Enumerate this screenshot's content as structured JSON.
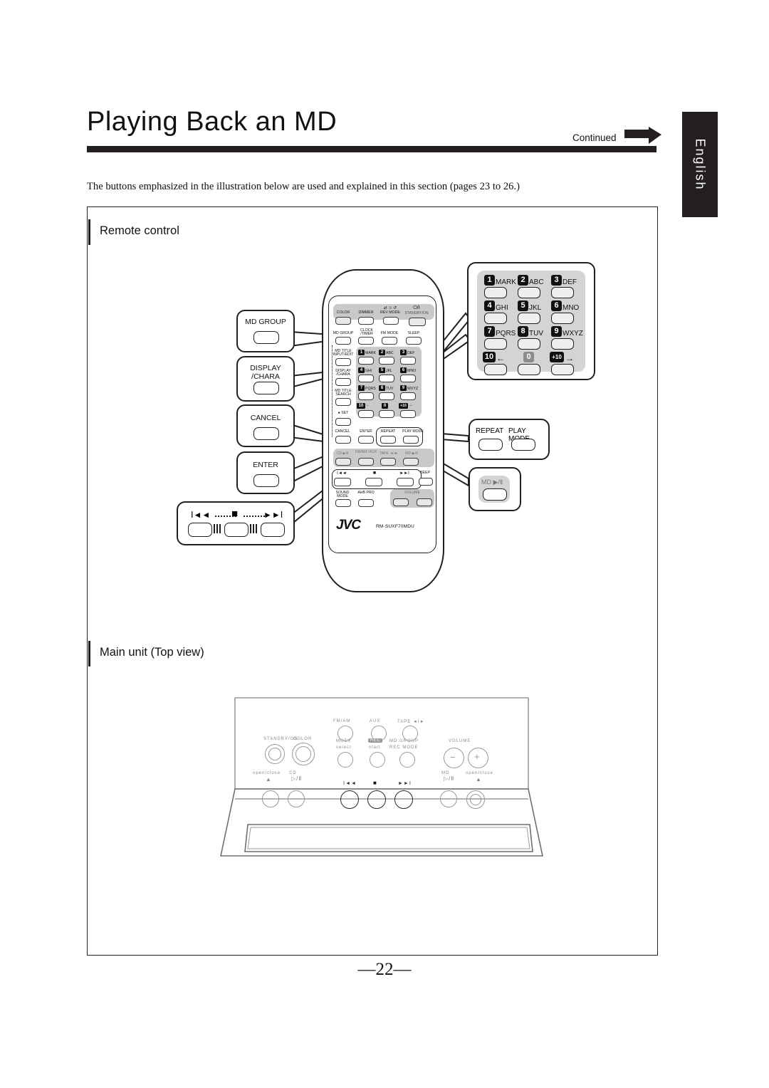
{
  "page": {
    "title": "Playing Back an MD",
    "continued": "Continued",
    "intro": "The buttons emphasized in the illustration below are used and explained in this section (pages 23 to 26.)",
    "language_tab": "English",
    "page_number": "—22—"
  },
  "sections": {
    "remote": "Remote control",
    "main_unit": "Main unit (Top view)"
  },
  "remote": {
    "brand": "JVC",
    "model": "RM-SUXF70MDU",
    "row_top": [
      {
        "label": "COLOR"
      },
      {
        "label": "DIMMER"
      },
      {
        "label": "REV MODE"
      },
      {
        "label": "STANDBY/ON"
      }
    ],
    "row_two": [
      {
        "label": "MD GROUP"
      },
      {
        "label": "CLOCK /TIMER"
      },
      {
        "label": "FM MODE"
      },
      {
        "label": "SLEEP"
      }
    ],
    "left_column": [
      {
        "label": "MD TITLE INPUT/EDIT"
      },
      {
        "label": "DISPLAY /CHARA"
      },
      {
        "label": "MD TITLE SEARCH"
      },
      {
        "label": "● SET"
      }
    ],
    "keypad": [
      {
        "num": "1",
        "letters": "MARK"
      },
      {
        "num": "2",
        "letters": "ABC"
      },
      {
        "num": "3",
        "letters": "DEF"
      },
      {
        "num": "4",
        "letters": "GHI"
      },
      {
        "num": "5",
        "letters": "JKL"
      },
      {
        "num": "6",
        "letters": "MNO"
      },
      {
        "num": "7",
        "letters": "PQRS"
      },
      {
        "num": "8",
        "letters": "TUV"
      },
      {
        "num": "9",
        "letters": "WXYZ"
      },
      {
        "num": "10",
        "letters": "←"
      },
      {
        "num": "0",
        "letters": ""
      },
      {
        "num": "+10",
        "letters": "→"
      }
    ],
    "row_cancel": [
      {
        "label": "CANCEL"
      },
      {
        "label": "ENTER"
      },
      {
        "label": "REPEAT"
      },
      {
        "label": "PLAY MODE"
      }
    ],
    "row_source": [
      {
        "label": "CD ▶/Ⅱ"
      },
      {
        "label": "FM/AM /AUX"
      },
      {
        "label": "TAPE ◄Ⅰ►"
      },
      {
        "label": "MD ▶/Ⅱ"
      }
    ],
    "row_transport": {
      "rew": "Ⅰ◄◄",
      "stop": "■",
      "ff": "►►Ⅰ",
      "beep": "BEEP"
    },
    "row_sound": [
      {
        "label": "SOUND MODE"
      },
      {
        "label": "AHB PRO"
      },
      {
        "label": "VOLUME"
      }
    ]
  },
  "callouts": {
    "left": [
      {
        "label": "MD GROUP"
      },
      {
        "label": "DISPLAY /CHARA"
      },
      {
        "label": "CANCEL"
      },
      {
        "label": "ENTER"
      }
    ],
    "transport": {
      "rew": "Ⅰ◄◄",
      "stop": "■",
      "ff": "►►Ⅰ"
    },
    "keypad_title": "",
    "repeat_playmode": [
      {
        "label": "REPEAT"
      },
      {
        "label": "PLAY MODE"
      }
    ],
    "md_play": {
      "label": "MD ▶/Ⅱ"
    }
  },
  "main_unit": {
    "left_controls": [
      {
        "label": "STANDBY/ON"
      },
      {
        "label": "COLOR"
      }
    ],
    "source_row": [
      {
        "label": "FM/AM"
      },
      {
        "label": "AUX"
      },
      {
        "label": "TAPE ◄Ⅰ►"
      }
    ],
    "mode_row": [
      {
        "label": "MODE",
        "sub": "select"
      },
      {
        "label": "REC",
        "sub": "start"
      },
      {
        "label": "MD GROUP",
        "sub": "REC MODE"
      }
    ],
    "volume": {
      "label": "VOLUME",
      "minus": "−",
      "plus": "+"
    },
    "front_left": {
      "open_close": "open/close",
      "cd": "CD",
      "eject": "▲",
      "play": "▷/Ⅱ"
    },
    "front_center": [
      {
        "label": "Ⅰ◄◄"
      },
      {
        "label": "■"
      },
      {
        "label": "►►Ⅰ"
      }
    ],
    "front_right": {
      "md": "MD",
      "open_close": "open/close",
      "play": "▷/Ⅱ",
      "eject": "▲"
    }
  }
}
